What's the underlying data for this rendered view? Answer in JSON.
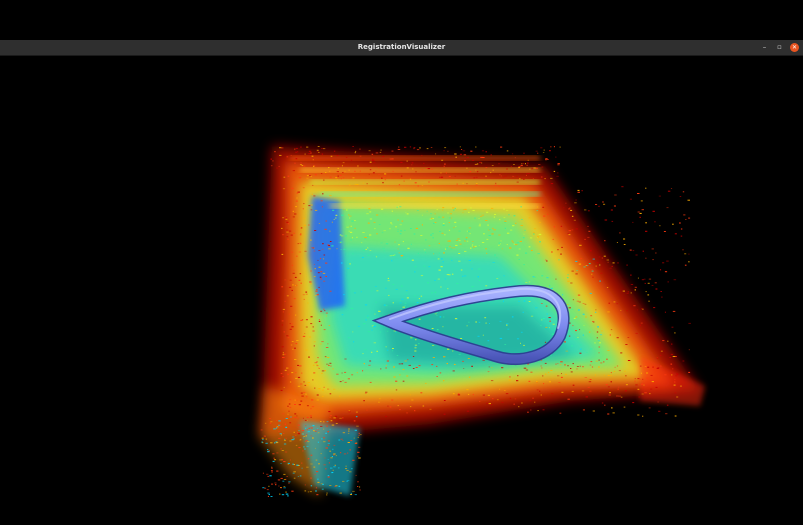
{
  "window": {
    "title": "RegistrationVisualizer",
    "controls": {
      "minimize": "–",
      "maximize": "▫",
      "close": "✕"
    }
  },
  "colors": {
    "background": "#000000",
    "titlebar": "#2f2f2f",
    "close_button": "#e95420",
    "trajectory": "#7f8cf0",
    "colormap": [
      "#1a3cff",
      "#00d8ff",
      "#30f0a0",
      "#d8ff30",
      "#ffb000",
      "#ff3a10",
      "#c80000"
    ]
  },
  "viewport": {
    "content": "point-cloud",
    "trajectory_visible": true
  }
}
